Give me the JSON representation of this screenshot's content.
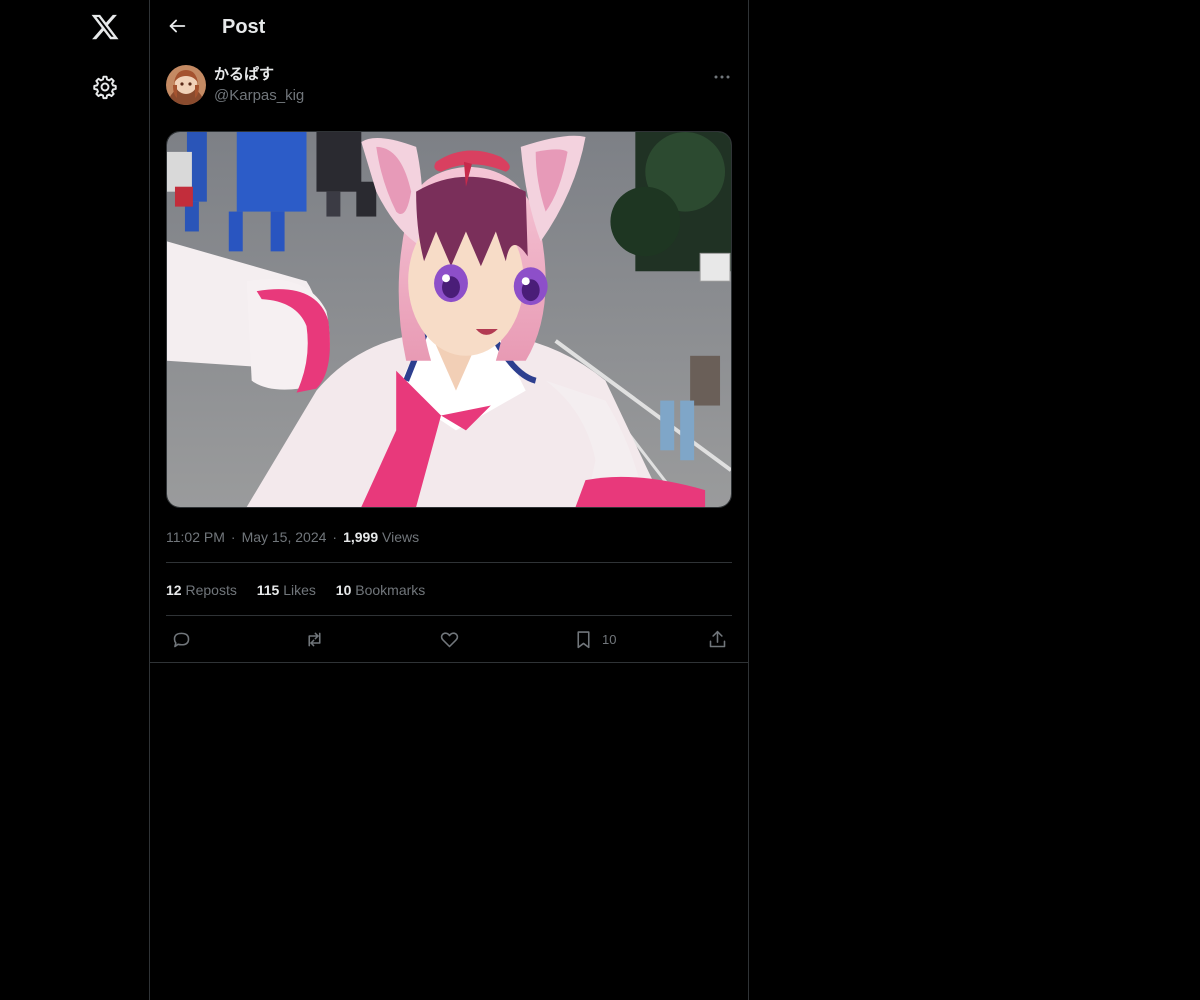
{
  "header": {
    "title": "Post"
  },
  "rail": {
    "logo_icon": "x-logo-icon",
    "settings_icon": "gear-icon"
  },
  "post": {
    "author": {
      "display_name": "かるぱす",
      "handle": "@Karpas_kig"
    },
    "media_description_icon": "photo",
    "time": "11:02 PM",
    "date": "May 15, 2024",
    "views_count": "1,999",
    "views_label": "Views",
    "stats": {
      "reposts_count": "12",
      "reposts_label": "Reposts",
      "likes_count": "115",
      "likes_label": "Likes",
      "bookmarks_count": "10",
      "bookmarks_label": "Bookmarks"
    },
    "actions": {
      "bookmark_count": "10"
    }
  },
  "colors": {
    "background": "#000000",
    "text_primary": "#e7e9ea",
    "text_secondary": "#71767b",
    "border": "#2f3336"
  }
}
